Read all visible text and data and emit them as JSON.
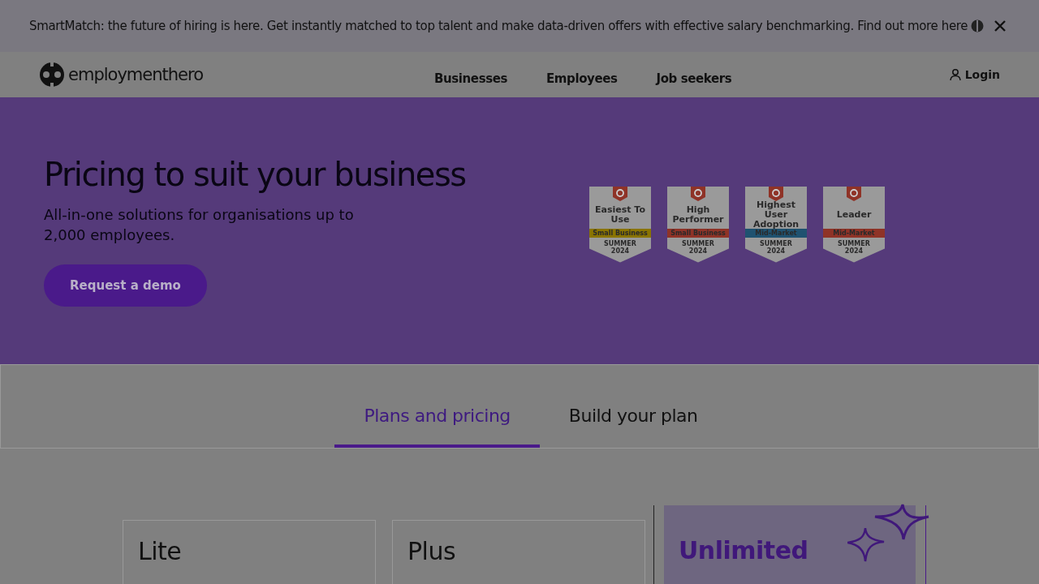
{
  "banner": {
    "text": "SmartMatch: the future of hiring is here. Get instantly matched to top talent and make data-driven offers with effective salary benchmarking. Find out more here"
  },
  "nav": {
    "logo": "employmenthero",
    "links": [
      "Businesses",
      "Employees",
      "Job seekers"
    ],
    "login": "Login"
  },
  "hero": {
    "title": "Pricing to suit your business",
    "subtitle": "All-in-one solutions for organisations up to 2,000 employees.",
    "button": "Request a demo",
    "badges": [
      {
        "title": "Easiest To Use",
        "segment": "Small Business",
        "season": "SUMMER",
        "year": "2024",
        "color": "#8a7400"
      },
      {
        "title": "High Performer",
        "segment": "Small Business",
        "season": "SUMMER",
        "year": "2024",
        "color": "#8f3327"
      },
      {
        "title": "Highest User Adoption",
        "segment": "Mid-Market",
        "season": "SUMMER",
        "year": "2024",
        "color": "#1f5270"
      },
      {
        "title": "Leader",
        "segment": "Mid-Market",
        "season": "SUMMER",
        "year": "2024",
        "color": "#8f3327"
      }
    ]
  },
  "tabs": [
    {
      "label": "Plans and pricing",
      "selected": true
    },
    {
      "label": "Build your plan",
      "selected": false
    }
  ],
  "plans": [
    {
      "name": "Lite",
      "featured": false
    },
    {
      "name": "Plus",
      "featured": false
    },
    {
      "name": "Unlimited",
      "featured": true
    }
  ]
}
